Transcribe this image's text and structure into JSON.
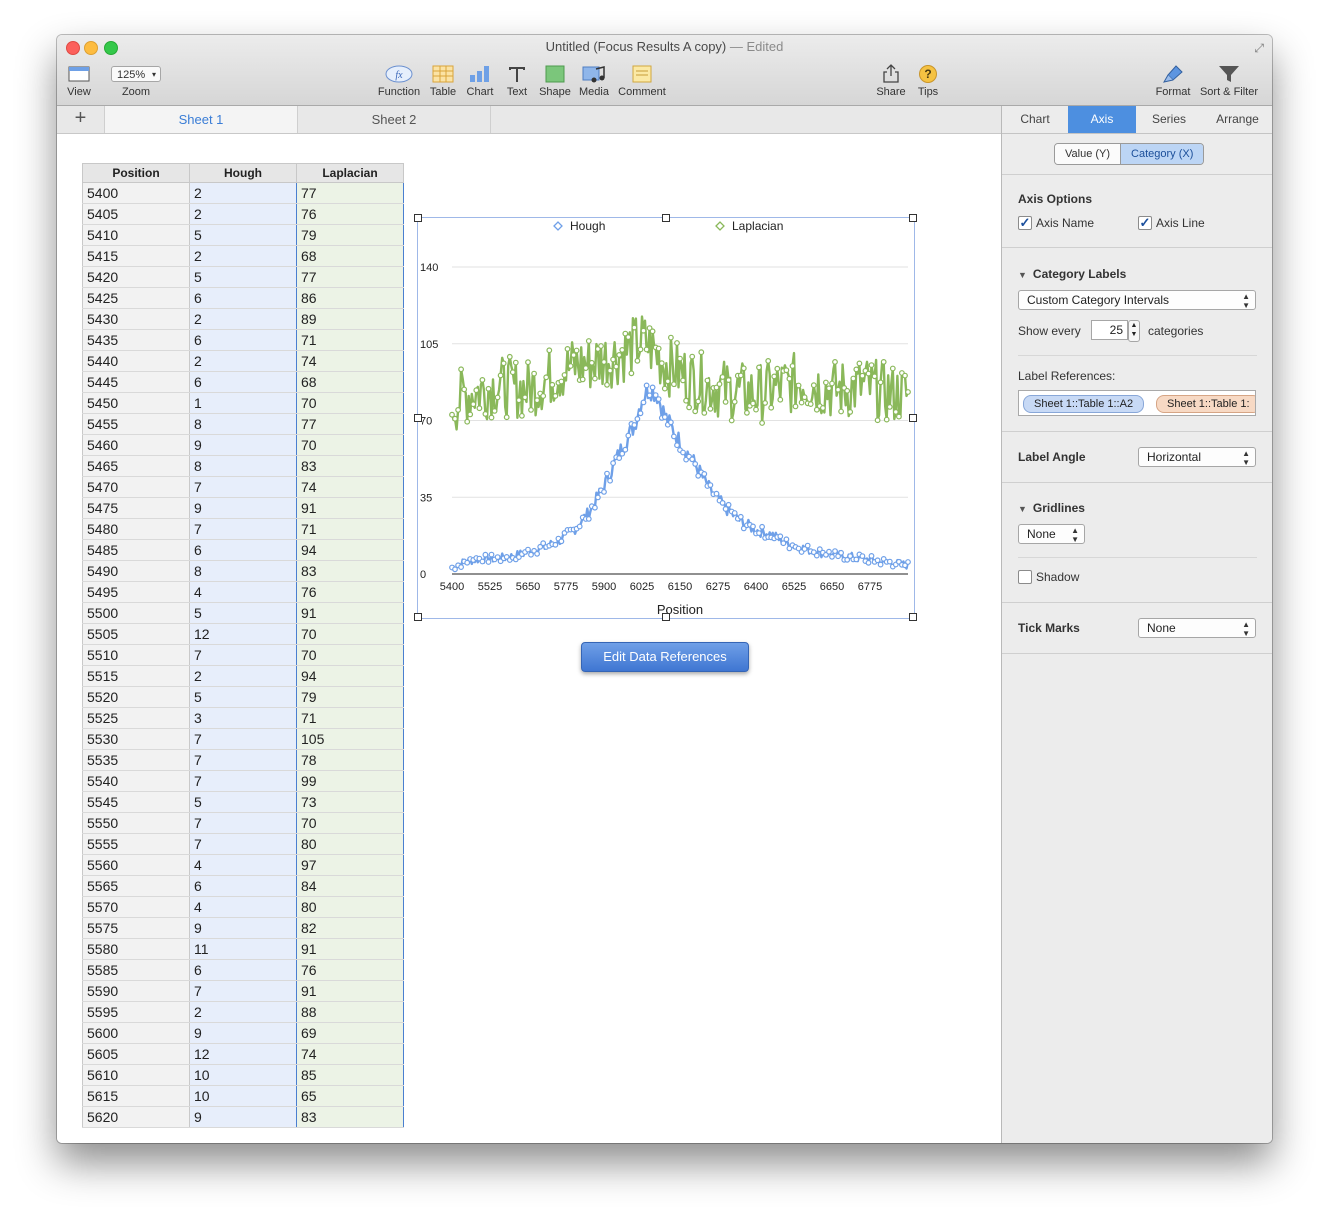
{
  "window": {
    "title": "Untitled (Focus Results A copy)",
    "edited_suffix": "— Edited"
  },
  "toolbar": {
    "view": "View",
    "zoom_value": "125%",
    "zoom": "Zoom",
    "function": "Function",
    "table": "Table",
    "chart": "Chart",
    "text": "Text",
    "shape": "Shape",
    "media": "Media",
    "comment": "Comment",
    "share": "Share",
    "tips": "Tips",
    "format": "Format",
    "sort_filter": "Sort & Filter"
  },
  "sheets": {
    "tabs": [
      "Sheet 1",
      "Sheet 2"
    ],
    "active": "Sheet 1"
  },
  "table": {
    "headers": [
      "Position",
      "Hough",
      "Laplacian"
    ],
    "rows": [
      [
        "5400",
        "2",
        "77"
      ],
      [
        "5405",
        "2",
        "76"
      ],
      [
        "5410",
        "5",
        "79"
      ],
      [
        "5415",
        "2",
        "68"
      ],
      [
        "5420",
        "5",
        "77"
      ],
      [
        "5425",
        "6",
        "86"
      ],
      [
        "5430",
        "2",
        "89"
      ],
      [
        "5435",
        "6",
        "71"
      ],
      [
        "5440",
        "2",
        "74"
      ],
      [
        "5445",
        "6",
        "68"
      ],
      [
        "5450",
        "1",
        "70"
      ],
      [
        "5455",
        "8",
        "77"
      ],
      [
        "5460",
        "9",
        "70"
      ],
      [
        "5465",
        "8",
        "83"
      ],
      [
        "5470",
        "7",
        "74"
      ],
      [
        "5475",
        "9",
        "91"
      ],
      [
        "5480",
        "7",
        "71"
      ],
      [
        "5485",
        "6",
        "94"
      ],
      [
        "5490",
        "8",
        "83"
      ],
      [
        "5495",
        "4",
        "76"
      ],
      [
        "5500",
        "5",
        "91"
      ],
      [
        "5505",
        "12",
        "70"
      ],
      [
        "5510",
        "7",
        "70"
      ],
      [
        "5515",
        "2",
        "94"
      ],
      [
        "5520",
        "5",
        "79"
      ],
      [
        "5525",
        "3",
        "71"
      ],
      [
        "5530",
        "7",
        "105"
      ],
      [
        "5535",
        "7",
        "78"
      ],
      [
        "5540",
        "7",
        "99"
      ],
      [
        "5545",
        "5",
        "73"
      ],
      [
        "5550",
        "7",
        "70"
      ],
      [
        "5555",
        "7",
        "80"
      ],
      [
        "5560",
        "4",
        "97"
      ],
      [
        "5565",
        "6",
        "84"
      ],
      [
        "5570",
        "4",
        "80"
      ],
      [
        "5575",
        "9",
        "82"
      ],
      [
        "5580",
        "11",
        "91"
      ],
      [
        "5585",
        "6",
        "76"
      ],
      [
        "5590",
        "7",
        "91"
      ],
      [
        "5595",
        "2",
        "88"
      ],
      [
        "5600",
        "9",
        "69"
      ],
      [
        "5605",
        "12",
        "74"
      ],
      [
        "5610",
        "10",
        "85"
      ],
      [
        "5615",
        "10",
        "65"
      ],
      [
        "5620",
        "9",
        "83"
      ]
    ]
  },
  "chart_data": {
    "type": "line",
    "xlabel": "Position",
    "ylabel": "",
    "ylim": [
      0,
      140
    ],
    "yticks": [
      0,
      35,
      70,
      105,
      140
    ],
    "xticks": [
      5400,
      5525,
      5650,
      5775,
      5900,
      6025,
      6150,
      6275,
      6400,
      6525,
      6650,
      6775
    ],
    "xrange": [
      5400,
      6900
    ],
    "step": 5,
    "grid": true,
    "legend": "top",
    "series": [
      {
        "name": "Hough",
        "color": "#6fa0e8",
        "marker": "circle-open",
        "x": [
          5400,
          5450,
          5500,
          5550,
          5600,
          5650,
          5700,
          5750,
          5800,
          5850,
          5900,
          5950,
          6000,
          6025,
          6050,
          6075,
          6100,
          6150,
          6200,
          6250,
          6300,
          6350,
          6400,
          6450,
          6500,
          6550,
          6600,
          6650,
          6700,
          6750,
          6800,
          6850,
          6900
        ],
        "values": [
          3,
          6,
          7,
          7,
          8,
          10,
          12,
          15,
          20,
          28,
          40,
          55,
          68,
          80,
          85,
          82,
          72,
          60,
          50,
          38,
          30,
          24,
          20,
          18,
          14,
          12,
          10,
          9,
          8,
          7,
          6,
          5,
          4
        ]
      },
      {
        "name": "Laplacian",
        "color": "#8ab85a",
        "marker": "circle-open",
        "x": [
          5400,
          5450,
          5500,
          5550,
          5600,
          5650,
          5700,
          5750,
          5800,
          5850,
          5900,
          5950,
          6000,
          6025,
          6050,
          6075,
          6100,
          6150,
          6200,
          6250,
          6300,
          6350,
          6400,
          6450,
          6500,
          6550,
          6600,
          6650,
          6700,
          6750,
          6800,
          6850,
          6900
        ],
        "values": [
          77,
          82,
          84,
          86,
          85,
          84,
          88,
          92,
          95,
          96,
          98,
          100,
          104,
          106,
          104,
          100,
          96,
          92,
          88,
          86,
          84,
          83,
          82,
          84,
          86,
          88,
          86,
          84,
          84,
          86,
          84,
          82,
          82
        ]
      }
    ]
  },
  "edit_data_button": "Edit Data References",
  "inspector": {
    "tabs": [
      "Chart",
      "Axis",
      "Series",
      "Arrange"
    ],
    "active_tab": "Axis",
    "segments": [
      "Value (Y)",
      "Category (X)"
    ],
    "active_segment": "Category (X)",
    "axis_options_title": "Axis Options",
    "axis_name": "Axis Name",
    "axis_line": "Axis Line",
    "category_labels_title": "Category Labels",
    "category_labels_value": "Custom Category Intervals",
    "show_every": "Show every",
    "show_every_value": "25",
    "categories": "categories",
    "label_references": "Label References:",
    "ref_tokens": [
      "Sheet 1::Table 1::A2",
      "Sheet 1::Table 1:"
    ],
    "label_angle": "Label Angle",
    "label_angle_value": "Horizontal",
    "gridlines_title": "Gridlines",
    "gridlines_value": "None",
    "shadow": "Shadow",
    "tick_marks": "Tick Marks",
    "tick_marks_value": "None"
  }
}
